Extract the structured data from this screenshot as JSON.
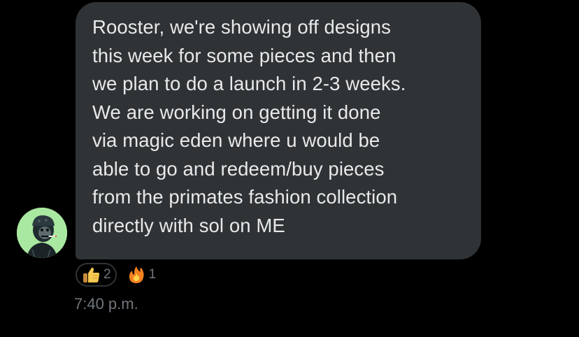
{
  "message": {
    "text": "Rooster, we're showing off designs\nthis week for some pieces and then\nwe plan to do a launch in 2-3 weeks.\nWe are working on getting it done\nvia magic eden where u would be\nable to go and redeem/buy pieces\nfrom the primates fashion collection\ndirectly with sol on ME"
  },
  "reactions": [
    {
      "icon": "thumbs-up-emoji",
      "count": "2",
      "active": true
    },
    {
      "icon": "fire-emoji",
      "count": "1",
      "active": false
    }
  ],
  "timestamp": "7:40 p.m.",
  "colors": {
    "background": "#000000",
    "bubble": "#2f3336",
    "text": "#e7e9ea",
    "muted": "#71767b",
    "avatar_bg": "#a9e8a0"
  }
}
